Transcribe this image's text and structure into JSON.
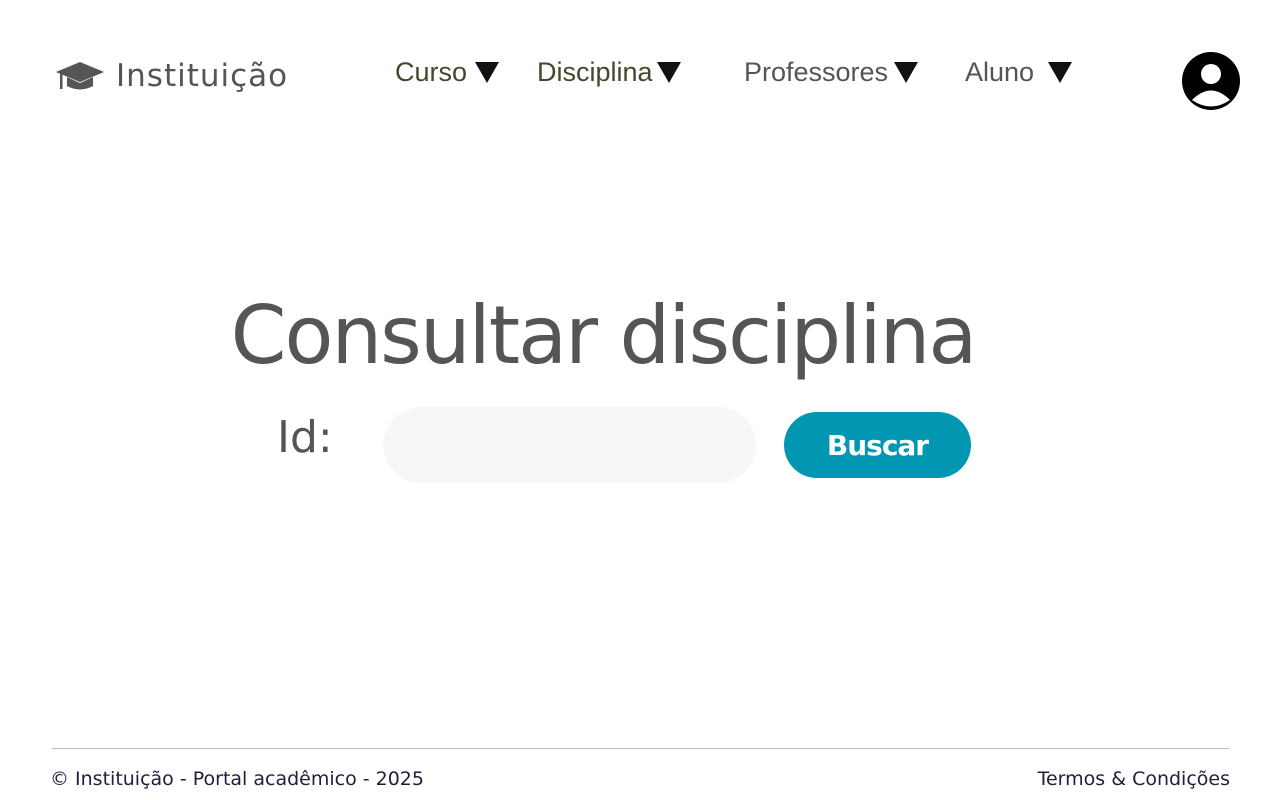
{
  "header": {
    "brand": {
      "name": "Instituição",
      "icon": "graduation-cap-icon"
    },
    "nav": [
      {
        "label": "Curso",
        "icon": "triangle-down-icon"
      },
      {
        "label": "Disciplina",
        "icon": "triangle-down-icon"
      },
      {
        "label": "Professores",
        "icon": "triangle-down-icon"
      },
      {
        "label": "Aluno",
        "icon": "triangle-down-icon"
      }
    ],
    "profile_icon": "user-circle-icon"
  },
  "main": {
    "title": "Consultar disciplina",
    "id_label": "Id:",
    "id_input": {
      "value": "",
      "placeholder": ""
    },
    "search_button": "Buscar"
  },
  "footer": {
    "copyright": "© Instituição - Portal acadêmico - 2025",
    "terms": "Termos & Condições"
  },
  "colors": {
    "primary_text": "#555555",
    "nav_active": "#3f4a2a",
    "button_bg": "#0197b2",
    "input_bg": "#f7f7f7",
    "footer_text": "#1f1f3a"
  }
}
